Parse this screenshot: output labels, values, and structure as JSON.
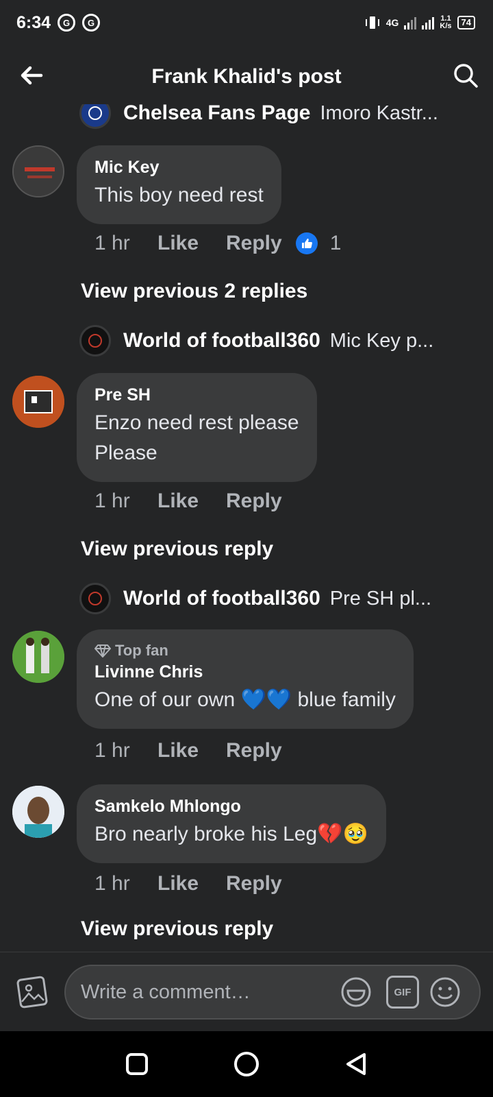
{
  "status_bar": {
    "time": "6:34",
    "network": "4G",
    "speed_value": "1.1",
    "speed_unit": "K/s",
    "battery": "74"
  },
  "header": {
    "title": "Frank Khalid's post"
  },
  "top_reply_preview": {
    "name": "Chelsea Fans Page",
    "text": "Imoro Kastr..."
  },
  "comments": [
    {
      "author": "Mic Key",
      "text": "This boy need rest",
      "time": "1 hr",
      "like_label": "Like",
      "reply_label": "Reply",
      "reaction_count": "1",
      "view_previous": "View previous 2 replies",
      "reply_preview": {
        "name": "World of football360",
        "text": "Mic Key  p..."
      }
    },
    {
      "author": "Pre SH",
      "text_line1": "Enzo need rest please",
      "text_line2": "Please",
      "time": "1 hr",
      "like_label": "Like",
      "reply_label": "Reply",
      "view_previous": "View previous reply",
      "reply_preview": {
        "name": "World of football360",
        "text": "Pre SH  pl..."
      }
    },
    {
      "badge": "Top fan",
      "author": "Livinne Chris",
      "text": "One of our own 💙💙 blue family",
      "time": "1 hr",
      "like_label": "Like",
      "reply_label": "Reply"
    },
    {
      "author": "Samkelo Mhlongo",
      "text": "Bro nearly broke his Leg💔🥹",
      "time": "1 hr",
      "like_label": "Like",
      "reply_label": "Reply",
      "view_previous": "View previous reply"
    }
  ],
  "composer": {
    "placeholder": "Write a comment…",
    "gif_label": "GIF"
  },
  "colors": {
    "background": "#242526",
    "bubble": "#3a3b3c",
    "like_blue": "#1877f2"
  }
}
